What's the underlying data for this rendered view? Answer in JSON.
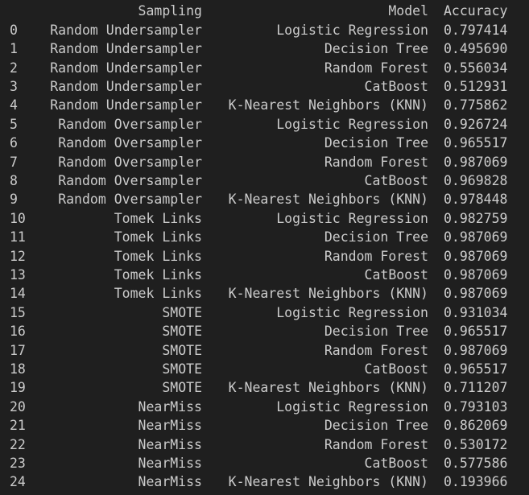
{
  "header": {
    "sampling": "Sampling",
    "model": "Model",
    "accuracy": "Accuracy"
  },
  "rows": [
    {
      "index": "0",
      "sampling": "Random Undersampler",
      "model": "Logistic Regression",
      "accuracy": "0.797414"
    },
    {
      "index": "1",
      "sampling": "Random Undersampler",
      "model": "Decision Tree",
      "accuracy": "0.495690"
    },
    {
      "index": "2",
      "sampling": "Random Undersampler",
      "model": "Random Forest",
      "accuracy": "0.556034"
    },
    {
      "index": "3",
      "sampling": "Random Undersampler",
      "model": "CatBoost",
      "accuracy": "0.512931"
    },
    {
      "index": "4",
      "sampling": "Random Undersampler",
      "model": "K-Nearest Neighbors (KNN)",
      "accuracy": "0.775862"
    },
    {
      "index": "5",
      "sampling": "Random Oversampler",
      "model": "Logistic Regression",
      "accuracy": "0.926724"
    },
    {
      "index": "6",
      "sampling": "Random Oversampler",
      "model": "Decision Tree",
      "accuracy": "0.965517"
    },
    {
      "index": "7",
      "sampling": "Random Oversampler",
      "model": "Random Forest",
      "accuracy": "0.987069"
    },
    {
      "index": "8",
      "sampling": "Random Oversampler",
      "model": "CatBoost",
      "accuracy": "0.969828"
    },
    {
      "index": "9",
      "sampling": "Random Oversampler",
      "model": "K-Nearest Neighbors (KNN)",
      "accuracy": "0.978448"
    },
    {
      "index": "10",
      "sampling": "Tomek Links",
      "model": "Logistic Regression",
      "accuracy": "0.982759"
    },
    {
      "index": "11",
      "sampling": "Tomek Links",
      "model": "Decision Tree",
      "accuracy": "0.987069"
    },
    {
      "index": "12",
      "sampling": "Tomek Links",
      "model": "Random Forest",
      "accuracy": "0.987069"
    },
    {
      "index": "13",
      "sampling": "Tomek Links",
      "model": "CatBoost",
      "accuracy": "0.987069"
    },
    {
      "index": "14",
      "sampling": "Tomek Links",
      "model": "K-Nearest Neighbors (KNN)",
      "accuracy": "0.987069"
    },
    {
      "index": "15",
      "sampling": "SMOTE",
      "model": "Logistic Regression",
      "accuracy": "0.931034"
    },
    {
      "index": "16",
      "sampling": "SMOTE",
      "model": "Decision Tree",
      "accuracy": "0.965517"
    },
    {
      "index": "17",
      "sampling": "SMOTE",
      "model": "Random Forest",
      "accuracy": "0.987069"
    },
    {
      "index": "18",
      "sampling": "SMOTE",
      "model": "CatBoost",
      "accuracy": "0.965517"
    },
    {
      "index": "19",
      "sampling": "SMOTE",
      "model": "K-Nearest Neighbors (KNN)",
      "accuracy": "0.711207"
    },
    {
      "index": "20",
      "sampling": "NearMiss",
      "model": "Logistic Regression",
      "accuracy": "0.793103"
    },
    {
      "index": "21",
      "sampling": "NearMiss",
      "model": "Decision Tree",
      "accuracy": "0.862069"
    },
    {
      "index": "22",
      "sampling": "NearMiss",
      "model": "Random Forest",
      "accuracy": "0.530172"
    },
    {
      "index": "23",
      "sampling": "NearMiss",
      "model": "CatBoost",
      "accuracy": "0.577586"
    },
    {
      "index": "24",
      "sampling": "NearMiss",
      "model": "K-Nearest Neighbors (KNN)",
      "accuracy": "0.193966"
    }
  ]
}
